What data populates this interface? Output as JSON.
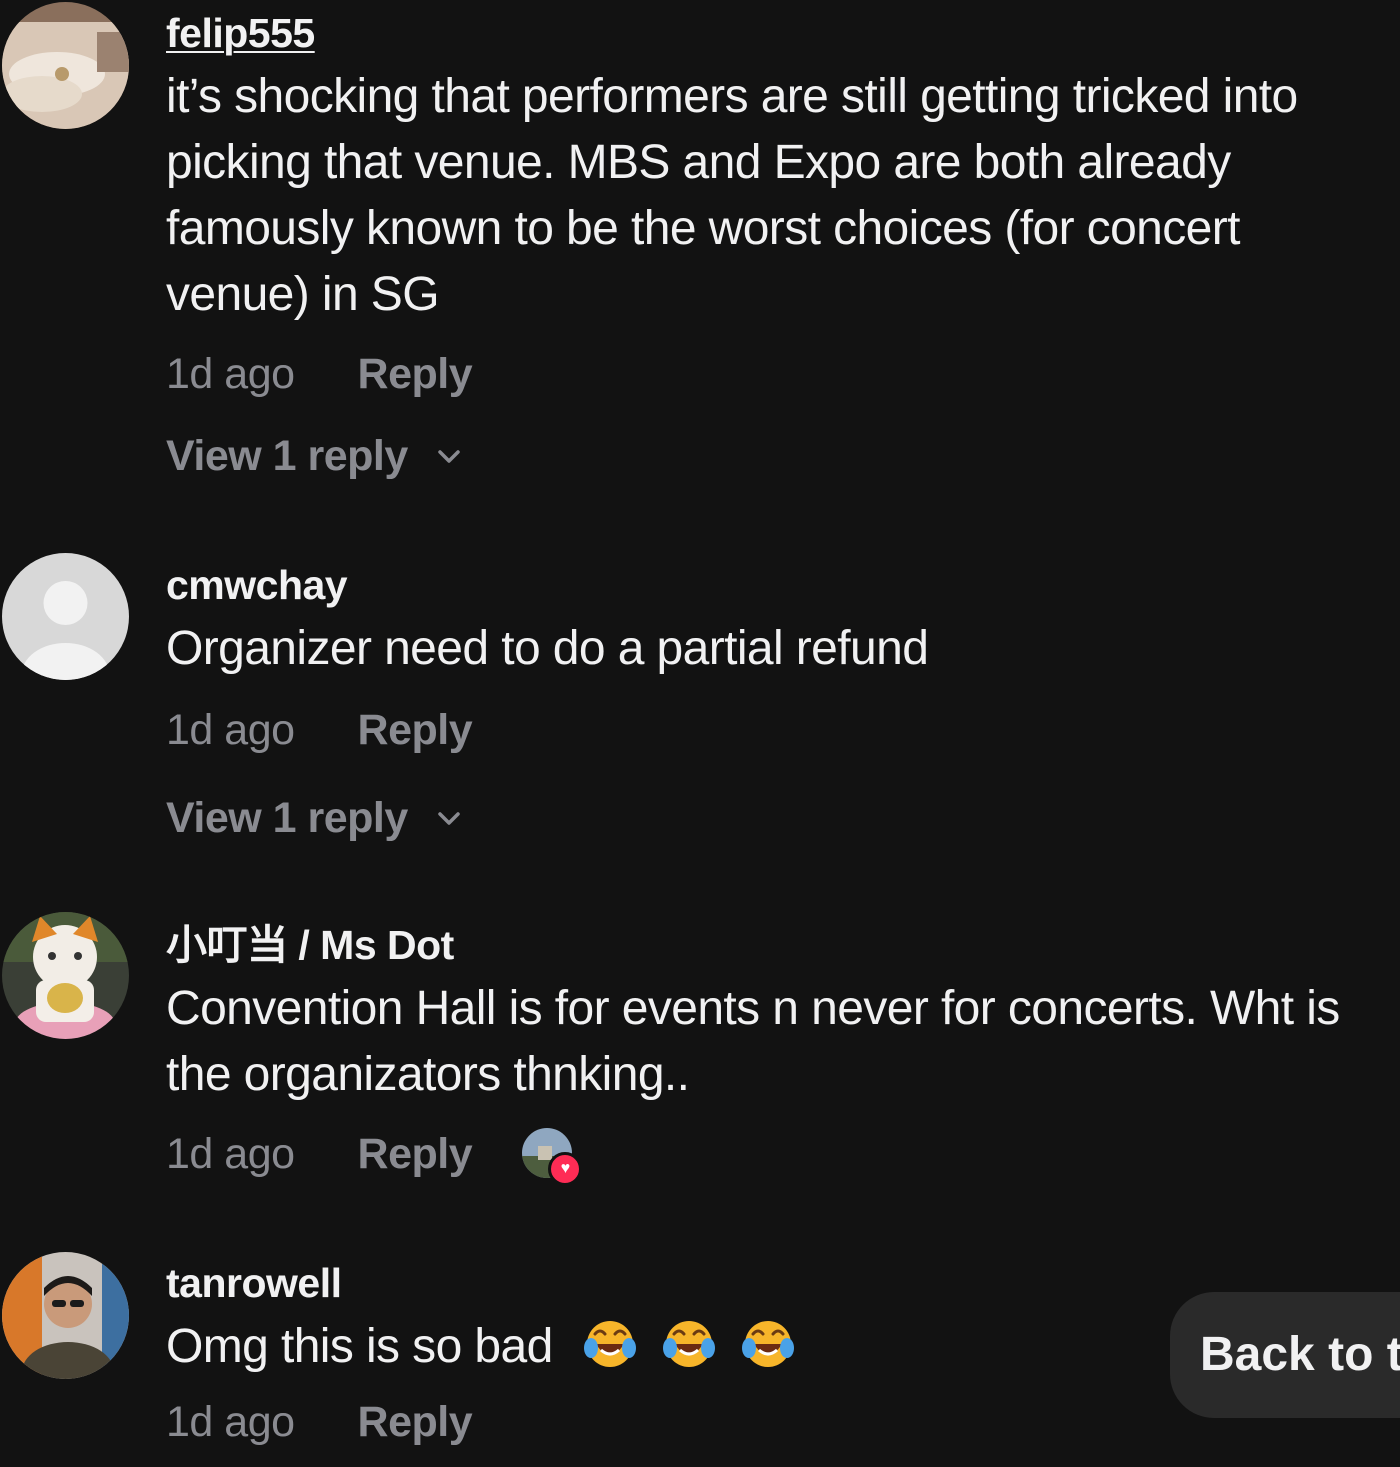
{
  "comments": [
    {
      "username": "felip555",
      "text": "it’s shocking that performers are still getting tricked into picking that venue. MBS and Expo are both already famously known to be the worst choices (for concert venue) in SG",
      "time": "1d ago",
      "reply_label": "Reply",
      "view_replies": "View 1 reply",
      "avatar": "photo-bed-avatar"
    },
    {
      "username": "cmwchay",
      "text": "Organizer need to do a partial refund",
      "time": "1d ago",
      "reply_label": "Reply",
      "view_replies": "View 1 reply",
      "avatar": "default-user-avatar"
    },
    {
      "username": "小叮当 / Ms Dot",
      "text": "Convention Hall is for events n never for concerts. Wht is the organizators thnking..",
      "time": "1d ago",
      "reply_label": "Reply",
      "liked_by_creator": true,
      "avatar": "lucky-cat-avatar"
    },
    {
      "username": "tanrowell",
      "text": "Omg this is so bad",
      "emojis": [
        "face-with-tears-of-joy",
        "face-with-tears-of-joy",
        "face-with-tears-of-joy"
      ],
      "time": "1d ago",
      "reply_label": "Reply",
      "avatar": "man-photo-avatar"
    }
  ],
  "back_to_top": "Back to top",
  "colors": {
    "background": "#121212",
    "primary_text": "#f1f1f2",
    "secondary_text": "#8a8b91",
    "like_heart": "#fe2c55",
    "pill_background": "#2a2a2a"
  }
}
